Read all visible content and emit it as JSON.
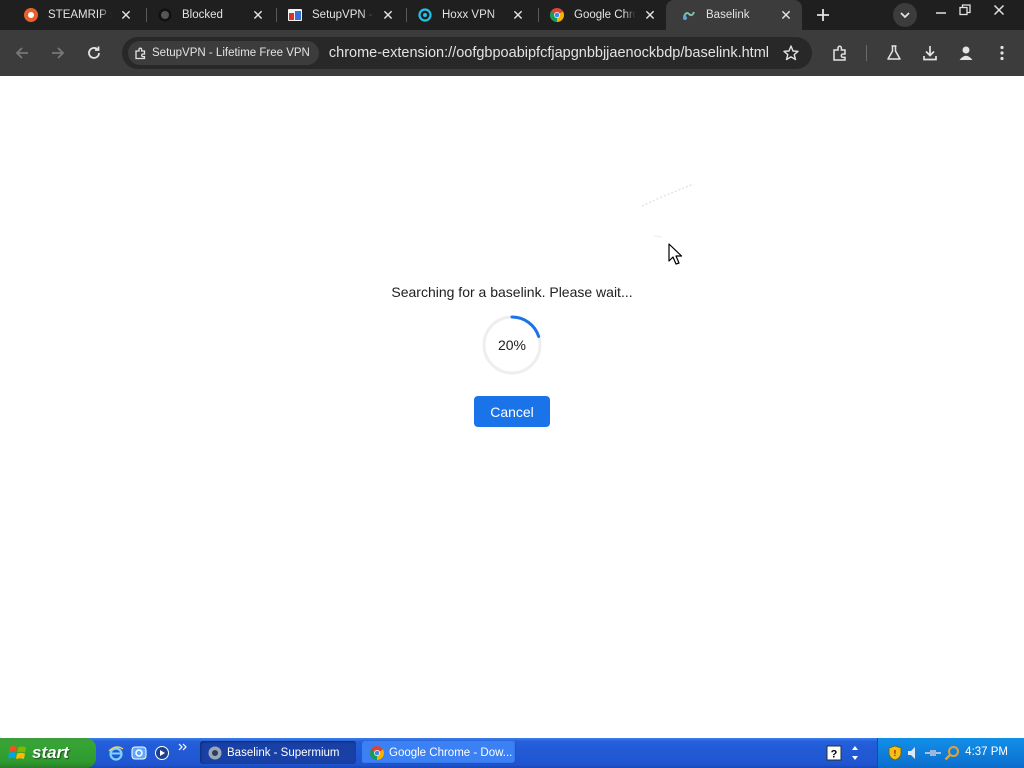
{
  "tabs": [
    {
      "title": "STEAMRIP » ",
      "icon": "steamrip-icon",
      "active": false
    },
    {
      "title": "Blocked",
      "icon": "github-icon",
      "active": false
    },
    {
      "title": "SetupVPN - ",
      "icon": "setupvpn-icon",
      "active": false
    },
    {
      "title": "Hoxx VPN",
      "icon": "hoxx-icon",
      "active": false
    },
    {
      "title": "Google Chro",
      "icon": "chrome-icon",
      "active": false
    },
    {
      "title": "Baselink",
      "icon": "baselink-icon",
      "active": true
    }
  ],
  "toolbar": {
    "extension_chip": "SetupVPN - Lifetime Free VPN",
    "url": "chrome-extension://oofgbpoabipfcfjapgnbbjjaenockbdp/baselink.html"
  },
  "page": {
    "message": "Searching for a baselink. Please wait...",
    "progress_label": "20%",
    "progress": 0.2,
    "cancel_label": "Cancel",
    "accent": "#1a73e8"
  },
  "taskbar": {
    "start_label": "start",
    "buttons": [
      {
        "label": "Baselink - Supermium",
        "active": true
      },
      {
        "label": "Google Chrome - Dow...",
        "active": false
      }
    ],
    "clock": "4:37 PM"
  }
}
